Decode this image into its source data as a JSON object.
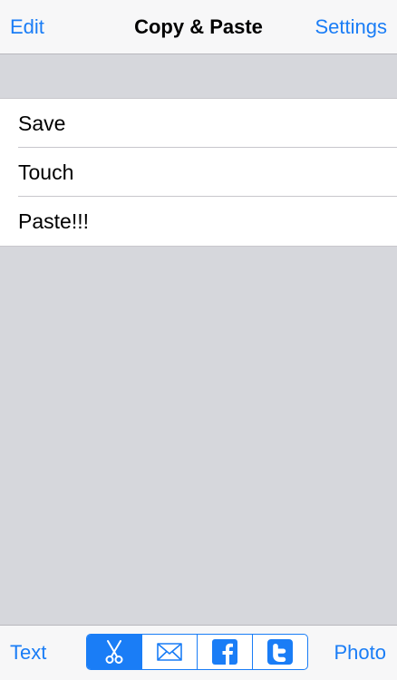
{
  "navbar": {
    "left_label": "Edit",
    "title": "Copy & Paste",
    "right_label": "Settings"
  },
  "list": {
    "items": [
      {
        "label": "Save"
      },
      {
        "label": "Touch"
      },
      {
        "label": "Paste!!!"
      }
    ]
  },
  "toolbar": {
    "left_label": "Text",
    "right_label": "Photo",
    "segments": [
      {
        "icon": "scissors-icon",
        "selected": true
      },
      {
        "icon": "mail-icon",
        "selected": false
      },
      {
        "icon": "facebook-icon",
        "selected": false
      },
      {
        "icon": "twitter-icon",
        "selected": false
      }
    ]
  },
  "colors": {
    "accent": "#1a7df6",
    "background": "#d6d7dc",
    "bar": "#f7f7f8"
  }
}
